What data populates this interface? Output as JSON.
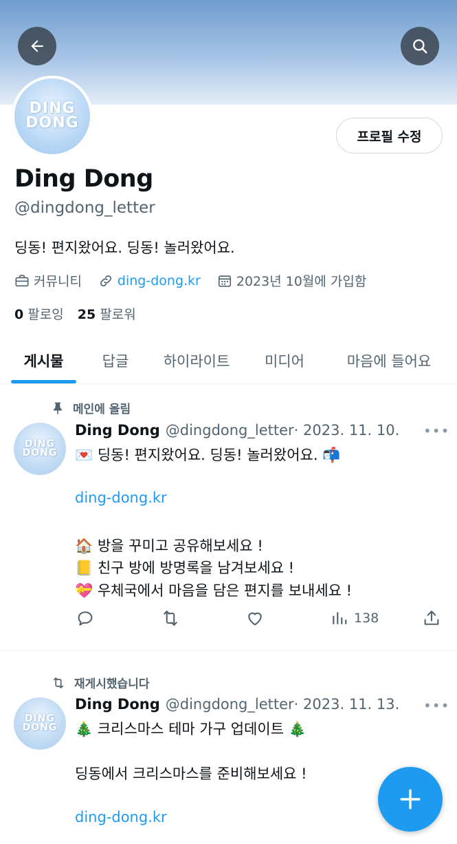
{
  "header": {
    "back_icon": "arrow-left-icon",
    "search_icon": "search-icon",
    "banner_colors": [
      "#6f9ccf",
      "#e3edf8"
    ]
  },
  "profile": {
    "avatar_logo": "DING DONG",
    "edit_button": "프로필 수정",
    "name": "Ding Dong",
    "handle": "@dingdong_letter",
    "bio": "딩동! 편지왔어요. 딩동! 놀러왔어요.",
    "category": "커뮤니티",
    "link": "ding-dong.kr",
    "joined": "2023년 10월에 가입함",
    "following_count": "0",
    "following_label": "팔로잉",
    "followers_count": "25",
    "followers_label": "팔로워"
  },
  "tabs": [
    "게시물",
    "답글",
    "하이라이트",
    "미디어",
    "마음에 들어요"
  ],
  "posts": [
    {
      "context": "메인에 올림",
      "name": "Ding Dong",
      "handle": "@dingdong_letter",
      "date": "· 2023. 11. 10.",
      "lines": [
        "💌 딩동! 편지왔어요. 딩동! 놀러왔어요. 📬",
        "ding-dong.kr",
        "🏠 방을 꾸미고 공유해보세요 !",
        "📒 친구 방에 방명록을 남겨보세요 !",
        "💝 우체국에서 마음을 담은 편지를 보내세요 !"
      ],
      "views": "138"
    },
    {
      "context": "재게시했습니다",
      "name": "Ding Dong",
      "handle": "@dingdong_letter",
      "date": "· 2023. 11. 13.",
      "lines": [
        "🎄 크리스마스 테마 가구 업데이트 🎄",
        "딩동에서 크리스마스를 준비해보세요 !",
        "ding-dong.kr"
      ]
    }
  ],
  "more_label": "•••",
  "accent_color": "#1d9bf0"
}
